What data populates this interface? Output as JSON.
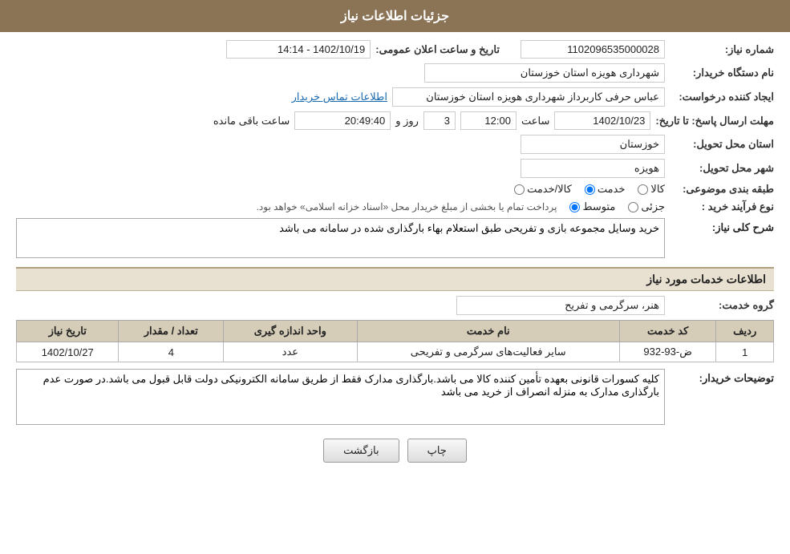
{
  "header": {
    "title": "جزئیات اطلاعات نیاز"
  },
  "fields": {
    "shomara_niaz_label": "شماره نیاز:",
    "shomara_niaz_value": "1102096535000028",
    "nam_dastgah_label": "نام دستگاه خریدار:",
    "nam_dastgah_value": "شهرداری هویزه استان خوزستان",
    "ejad_konande_label": "ایجاد کننده درخواست:",
    "ejad_konande_value": "عباس حرفی کاربرداز شهرداری هویزه استان خوزستان",
    "ettelaat_link": "اطلاعات تماس خریدار",
    "mohlat_label": "مهلت ارسال پاسخ: تا تاریخ:",
    "mohlat_date": "1402/10/23",
    "mohlat_saat_label": "ساعت",
    "mohlat_saat": "12:00",
    "mohlat_roz_label": "روز و",
    "mohlat_roz": "3",
    "mohlat_mande_label": "ساعت باقی مانده",
    "mohlat_mande": "20:49:40",
    "ostan_label": "استان محل تحویل:",
    "ostan_value": "خوزستان",
    "shahr_label": "شهر محل تحویل:",
    "shahr_value": "هویزه",
    "tabagheh_label": "طبقه بندی موضوعی:",
    "tabagheh_kala": "کالا",
    "tabagheh_khedmat": "خدمت",
    "tabagheh_kala_khedmat": "کالا/خدمت",
    "tabagheh_selected": "khedmat",
    "noع_farayand_label": "نوع فرآیند خرید :",
    "noع_joزئی": "جزئی",
    "noع_motavaset": "متوسط",
    "noع_note": "پرداخت تمام یا بخشی از مبلغ خریدار محل «اسناد خزانه اسلامی» خواهد بود.",
    "sharh_label": "شرح کلی نیاز:",
    "sharh_value": "خرید وسایل مجموعه بازی و تفریحی طبق استعلام بهاء بارگذاری شده در سامانه می باشد",
    "khadamat_label": "اطلاعات خدمات مورد نیاز",
    "gorooh_label": "گروه خدمت:",
    "gorooh_value": "هنر، سرگرمی و تفریح",
    "tarikh_elan_label": "تاریخ و ساعت اعلان عمومی:",
    "tarikh_elan_value": "1402/10/19 - 14:14",
    "table": {
      "headers": [
        "ردیف",
        "کد خدمت",
        "نام خدمت",
        "واحد اندازه گیری",
        "تعداد / مقدار",
        "تاریخ نیاز"
      ],
      "rows": [
        {
          "radif": "1",
          "kod_khedmat": "ض-93-932",
          "nam_khedmat": "سایر فعالیت‌های سرگرمی و تفریحی",
          "vahed": "عدد",
          "tedad": "4",
          "tarikh": "1402/10/27"
        }
      ]
    },
    "توضیحات_label": "توضیحات خریدار:",
    "توضیحات_value": "کلیه کسورات قانونی بعهده تأمین کننده کالا می باشد.بارگذاری مدارک فقط از طریق سامانه الکترونیکی دولت قابل قبول می باشد.در صورت عدم بارگذاری مدارک به منزله انصراف از خرید می باشد",
    "btn_print": "چاپ",
    "btn_back": "بازگشت"
  }
}
